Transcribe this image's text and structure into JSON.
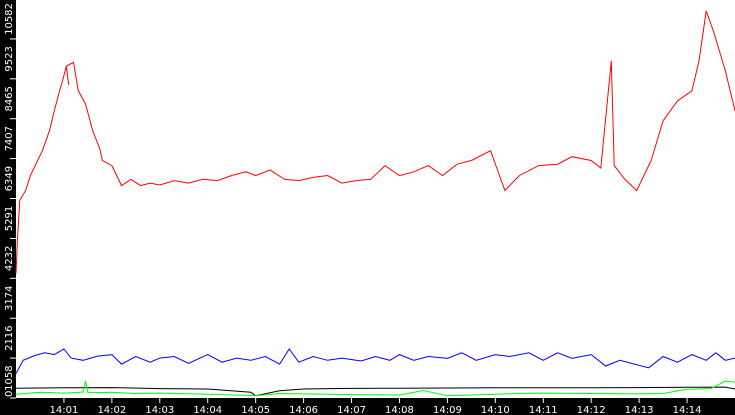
{
  "chart_data": {
    "type": "line",
    "title": "",
    "xlabel": "",
    "ylabel": "",
    "x_unit": "minutes after 14:00",
    "xlim": [
      0,
      15
    ],
    "ylim": [
      0,
      10582
    ],
    "yticks": [
      0,
      1058,
      2116,
      3174,
      4232,
      5291,
      6349,
      7407,
      8465,
      9523,
      10582
    ],
    "ytick_labels": [
      "0",
      "1058",
      "2116",
      "3174",
      "4232",
      "5291",
      "6349",
      "7407",
      "8465",
      "9523",
      "10582"
    ],
    "xticks": [
      1,
      2,
      3,
      4,
      5,
      6,
      7,
      8,
      9,
      10,
      11,
      12,
      13,
      14
    ],
    "xtick_labels": [
      "14:01",
      "14:02",
      "14:03",
      "14:04",
      "14:05",
      "14:06",
      "14:07",
      "14:08",
      "14:09",
      "14:10",
      "14:11",
      "14:12",
      "14:13",
      "14:14"
    ],
    "grid": false,
    "series": [
      {
        "name": "red",
        "color": "#ff0000",
        "points": [
          [
            0,
            3300
          ],
          [
            0.03,
            4180
          ],
          [
            0.08,
            5240
          ],
          [
            0.2,
            5500
          ],
          [
            0.3,
            5900
          ],
          [
            0.45,
            6300
          ],
          [
            0.55,
            6560
          ],
          [
            0.7,
            7100
          ],
          [
            0.8,
            7618
          ],
          [
            0.9,
            8100
          ],
          [
            0.97,
            8411
          ],
          [
            1.05,
            8800
          ],
          [
            1.1,
            8300
          ],
          [
            1.05,
            8800
          ],
          [
            1.2,
            8900
          ],
          [
            1.3,
            8147
          ],
          [
            1.45,
            7800
          ],
          [
            1.6,
            7089
          ],
          [
            1.75,
            6600
          ],
          [
            1.8,
            6295
          ],
          [
            2.0,
            6163
          ],
          [
            2.2,
            5634
          ],
          [
            2.4,
            5800
          ],
          [
            2.6,
            5634
          ],
          [
            2.8,
            5700
          ],
          [
            3.0,
            5650
          ],
          [
            3.3,
            5766
          ],
          [
            3.6,
            5700
          ],
          [
            3.9,
            5800
          ],
          [
            4.2,
            5766
          ],
          [
            4.5,
            5900
          ],
          [
            4.8,
            6000
          ],
          [
            5.0,
            5898
          ],
          [
            5.3,
            6050
          ],
          [
            5.6,
            5800
          ],
          [
            5.9,
            5766
          ],
          [
            6.2,
            5850
          ],
          [
            6.5,
            5900
          ],
          [
            6.8,
            5700
          ],
          [
            7.1,
            5766
          ],
          [
            7.4,
            5800
          ],
          [
            7.7,
            6163
          ],
          [
            8.0,
            5898
          ],
          [
            8.3,
            6000
          ],
          [
            8.6,
            6163
          ],
          [
            8.9,
            5900
          ],
          [
            9.2,
            6200
          ],
          [
            9.5,
            6300
          ],
          [
            9.9,
            6560
          ],
          [
            10.2,
            5502
          ],
          [
            10.5,
            5898
          ],
          [
            10.9,
            6163
          ],
          [
            11.3,
            6200
          ],
          [
            11.6,
            6400
          ],
          [
            12.0,
            6300
          ],
          [
            12.2,
            6100
          ],
          [
            12.42,
            8940
          ],
          [
            12.48,
            6163
          ],
          [
            12.7,
            5800
          ],
          [
            12.95,
            5502
          ],
          [
            13.25,
            6295
          ],
          [
            13.5,
            7353
          ],
          [
            13.8,
            7882
          ],
          [
            14.1,
            8147
          ],
          [
            14.25,
            8940
          ],
          [
            14.4,
            10263
          ],
          [
            14.55,
            9734
          ],
          [
            14.8,
            8676
          ],
          [
            15.0,
            7618
          ]
        ]
      },
      {
        "name": "blue",
        "color": "#0000ff",
        "points": [
          [
            0,
            650
          ],
          [
            0.15,
            1000
          ],
          [
            0.4,
            1130
          ],
          [
            0.6,
            1200
          ],
          [
            0.8,
            1150
          ],
          [
            1.0,
            1300
          ],
          [
            1.15,
            1058
          ],
          [
            1.4,
            1000
          ],
          [
            1.7,
            1110
          ],
          [
            2.0,
            1150
          ],
          [
            2.2,
            900
          ],
          [
            2.5,
            1100
          ],
          [
            2.8,
            950
          ],
          [
            3.0,
            1058
          ],
          [
            3.3,
            1100
          ],
          [
            3.6,
            920
          ],
          [
            4.0,
            1150
          ],
          [
            4.3,
            950
          ],
          [
            4.6,
            1058
          ],
          [
            4.9,
            1000
          ],
          [
            5.2,
            1100
          ],
          [
            5.5,
            900
          ],
          [
            5.7,
            1300
          ],
          [
            5.9,
            950
          ],
          [
            6.2,
            1100
          ],
          [
            6.5,
            1000
          ],
          [
            6.8,
            1058
          ],
          [
            7.2,
            980
          ],
          [
            7.5,
            1100
          ],
          [
            7.8,
            1000
          ],
          [
            8.0,
            1150
          ],
          [
            8.3,
            1000
          ],
          [
            8.6,
            1100
          ],
          [
            9.0,
            1050
          ],
          [
            9.3,
            1200
          ],
          [
            9.6,
            1000
          ],
          [
            10.0,
            1150
          ],
          [
            10.3,
            1100
          ],
          [
            10.7,
            1200
          ],
          [
            11.0,
            1000
          ],
          [
            11.3,
            1200
          ],
          [
            11.6,
            1050
          ],
          [
            12.0,
            1150
          ],
          [
            12.3,
            850
          ],
          [
            12.6,
            1000
          ],
          [
            12.9,
            900
          ],
          [
            13.2,
            800
          ],
          [
            13.5,
            1100
          ],
          [
            13.8,
            950
          ],
          [
            14.1,
            1150
          ],
          [
            14.4,
            1000
          ],
          [
            14.6,
            1200
          ],
          [
            14.8,
            1000
          ],
          [
            15.0,
            1058
          ]
        ]
      },
      {
        "name": "black",
        "color": "#000000",
        "points": [
          [
            0,
            260
          ],
          [
            1.0,
            270
          ],
          [
            2.0,
            275
          ],
          [
            3.0,
            250
          ],
          [
            4.0,
            240
          ],
          [
            4.9,
            150
          ],
          [
            5.0,
            60
          ],
          [
            5.5,
            190
          ],
          [
            6.0,
            240
          ],
          [
            7.0,
            255
          ],
          [
            8.0,
            260
          ],
          [
            9.0,
            265
          ],
          [
            10.0,
            270
          ],
          [
            11.0,
            270
          ],
          [
            12.0,
            270
          ],
          [
            13.0,
            275
          ],
          [
            14.0,
            285
          ],
          [
            14.8,
            290
          ],
          [
            15.0,
            240
          ]
        ]
      },
      {
        "name": "green",
        "color": "#00ff00",
        "points": [
          [
            0,
            100
          ],
          [
            0.5,
            150
          ],
          [
            1.0,
            130
          ],
          [
            1.4,
            160
          ],
          [
            1.45,
            450
          ],
          [
            1.5,
            140
          ],
          [
            2.0,
            150
          ],
          [
            2.5,
            120
          ],
          [
            3.0,
            130
          ],
          [
            4.0,
            100
          ],
          [
            5.0,
            60
          ],
          [
            5.5,
            120
          ],
          [
            6.0,
            110
          ],
          [
            7.0,
            90
          ],
          [
            8.0,
            80
          ],
          [
            8.5,
            200
          ],
          [
            9.0,
            60
          ],
          [
            10.0,
            100
          ],
          [
            10.5,
            120
          ],
          [
            11.0,
            130
          ],
          [
            12.0,
            120
          ],
          [
            13.0,
            110
          ],
          [
            13.5,
            120
          ],
          [
            14.0,
            230
          ],
          [
            14.5,
            250
          ],
          [
            14.8,
            450
          ],
          [
            15.0,
            420
          ]
        ]
      }
    ]
  }
}
